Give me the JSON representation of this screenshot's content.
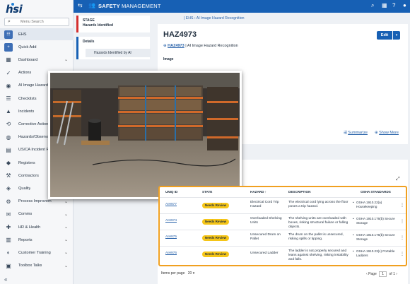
{
  "app": {
    "logo": "hsi",
    "title_bold": "SAFETY",
    "title_light": "MANAGEMENT"
  },
  "search": {
    "placeholder": "Menu Search"
  },
  "sidebar": {
    "items": [
      {
        "label": "EHS",
        "icon": "ehs-icon",
        "chevron": false
      },
      {
        "label": "Quick Add",
        "icon": "plus-icon",
        "chevron": false
      },
      {
        "label": "Dashboard",
        "icon": "dashboard-icon",
        "chevron": true
      },
      {
        "label": "Actions",
        "icon": "check-icon",
        "chevron": false
      },
      {
        "label": "AI Image Hazard R",
        "icon": "location-icon",
        "chevron": false
      },
      {
        "label": "Checklists",
        "icon": "checklist-icon",
        "chevron": false
      },
      {
        "label": "Incidents",
        "icon": "warning-icon",
        "chevron": false
      },
      {
        "label": "Corrective Actions",
        "icon": "corrective-icon",
        "chevron": false
      },
      {
        "label": "Hazards/Observati",
        "icon": "hazard-icon",
        "chevron": false
      },
      {
        "label": "US/CA Incident Re",
        "icon": "report-icon",
        "chevron": false
      },
      {
        "label": "Registers",
        "icon": "register-icon",
        "chevron": false
      },
      {
        "label": "Contractors",
        "icon": "contractor-icon",
        "chevron": false
      },
      {
        "label": "Quality",
        "icon": "quality-icon",
        "chevron": false
      },
      {
        "label": "Process Improvem",
        "icon": "process-icon",
        "chevron": true
      },
      {
        "label": "Comms",
        "icon": "comms-icon",
        "chevron": true
      },
      {
        "label": "HR & Health",
        "icon": "health-icon",
        "chevron": true
      },
      {
        "label": "Reports",
        "icon": "reports-icon",
        "chevron": true
      },
      {
        "label": "Customer Training",
        "icon": "training-icon",
        "chevron": true
      },
      {
        "label": "Toolbox Talks",
        "icon": "toolbox-icon",
        "chevron": true
      }
    ]
  },
  "breadcrumb": "| EHS  ›  AI Image Hazard Recognition",
  "stage": {
    "label": "STAGE",
    "value": "Hazards Identified"
  },
  "details": {
    "label": "Details",
    "row": "Hazards Identified by AI"
  },
  "record": {
    "id": "HAZ4973",
    "edit_label": "Edit",
    "link_text": "HAZ4973",
    "link_suffix": "| AI Image Hazard Recognition",
    "image_label": "Image",
    "summarize": "Summarize",
    "show_more": "Show More"
  },
  "table": {
    "headers": [
      "UNIQ ID",
      "STATE",
      "HAZARD ↑",
      "DESCRIPTION",
      "OSHA STANDARDS"
    ],
    "rows": [
      {
        "id": "AIH977",
        "state": "Needs Review",
        "hazard": "Electrical Cord Trip Hazard",
        "description": "The electrical cord lying across the floor poses a trip hazard.",
        "standard": "OSHA 1910.22(a) Housekeeping"
      },
      {
        "id": "AIH974",
        "state": "Needs Review",
        "hazard": "Overloaded Shelving Units",
        "description": "The shelving units are overloaded with boxes, risking structural failure or falling objects.",
        "standard": "OSHA 1910.176(b) Secure Storage"
      },
      {
        "id": "AIH975",
        "state": "Needs Review",
        "hazard": "Unsecured Drum on Pallet",
        "description": "The drum on the pallet is unsecured, risking spills or tipping.",
        "standard": "OSHA 1910.176(b) Secure Storage"
      },
      {
        "id": "AIH976",
        "state": "Needs Review",
        "hazard": "Unsecured Ladder",
        "description": "The ladder is not properly secured and leans against shelving, risking instability and falls.",
        "standard": "OSHA 1910.23(c) Portable Ladders"
      }
    ],
    "items_per_page_label": "Items per page",
    "items_per_page_value": "20",
    "page_label": "Page",
    "page_value": "1",
    "page_of": "of 1"
  },
  "colors": {
    "header": "#1760b4",
    "accent_orange": "#f0a020",
    "badge_yellow": "#f5c518",
    "stage_red": "#d32f2f"
  }
}
